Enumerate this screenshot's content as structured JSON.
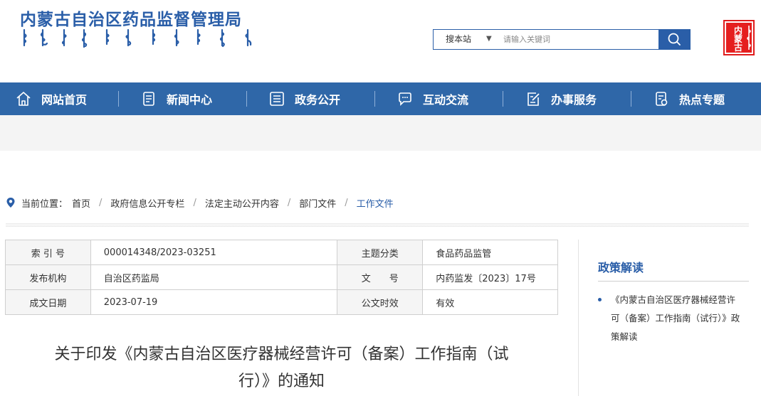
{
  "site": {
    "title": "内蒙古自治区药品监督管理局",
    "seal_chars": [
      "内",
      "蒙",
      "古"
    ]
  },
  "search": {
    "scope_label": "搜本站",
    "placeholder": "请输入关键词",
    "icon": "search-icon"
  },
  "nav": {
    "items": [
      {
        "label": "网站首页",
        "icon": "home-icon"
      },
      {
        "label": "新闻中心",
        "icon": "document-icon"
      },
      {
        "label": "政务公开",
        "icon": "list-icon"
      },
      {
        "label": "互动交流",
        "icon": "chat-icon"
      },
      {
        "label": "办事服务",
        "icon": "edit-icon"
      },
      {
        "label": "热点专题",
        "icon": "topic-icon"
      }
    ]
  },
  "breadcrumb": {
    "prefix": "当前位置：",
    "items": [
      "首页",
      "政府信息公开专栏",
      "法定主动公开内容",
      "部门文件",
      "工作文件"
    ]
  },
  "meta": {
    "rows": [
      {
        "k1": "索 引 号",
        "v1": "000014348/2023-03251",
        "k2": "主题分类",
        "v2": "食品药品监管"
      },
      {
        "k1": "发布机构",
        "v1": "自治区药监局",
        "k2": "文　　号",
        "v2": "内药监发〔2023〕17号"
      },
      {
        "k1": "成文日期",
        "v1": "2023-07-19",
        "k2": "公文时效",
        "v2": "有效"
      }
    ]
  },
  "article": {
    "title_line1": "关于印发《内蒙古自治区医疗器械经营许可（备案）工作指南（试",
    "title_line2": "行）》的通知"
  },
  "sidebar": {
    "title": "政策解读",
    "item": "《内蒙古自治区医疗器械经营许可（备案）工作指南（试行）》政策解读"
  },
  "colors": {
    "brand_blue": "#2f67a8",
    "seal_red": "#e51f1f"
  }
}
